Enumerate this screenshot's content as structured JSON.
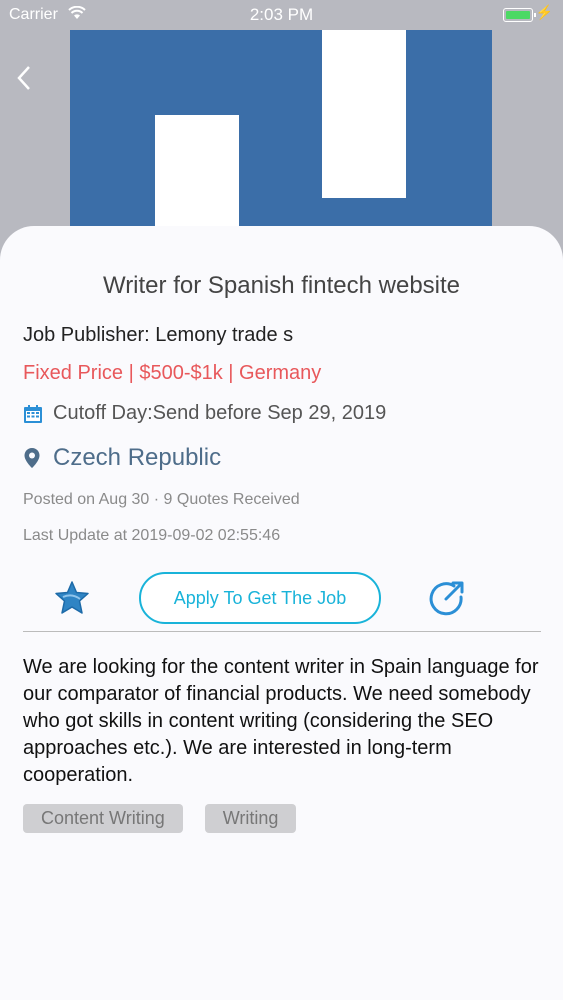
{
  "status_bar": {
    "carrier": "Carrier",
    "time": "2:03 PM"
  },
  "header": {
    "back_icon": "chevron-left-icon"
  },
  "job": {
    "title": "Writer for Spanish fintech website",
    "publisher": "Job Publisher: Lemony trade s",
    "price_line": "Fixed Price | $500-$1k | Germany",
    "cutoff": "Cutoff Day:Send before Sep 29, 2019",
    "location": "Czech Republic",
    "posted": "Posted on Aug 30 · 9 Quotes Received",
    "last_update": "Last Update at 2019-09-02 02:55:46",
    "description": "We are looking for the content writer in Spain language for our comparator of financial products. We need somebody who got skills in content writing (considering the SEO approaches etc.). We are interested in long-term cooperation.",
    "tags": [
      "Content Writing",
      "Writing"
    ]
  },
  "actions": {
    "apply_label": "Apply To Get The Job"
  },
  "colors": {
    "accent": "#19b3d9",
    "price": "#e8585b",
    "logo_blue": "#3b6ea8",
    "star_blue": "#2f84c4"
  }
}
